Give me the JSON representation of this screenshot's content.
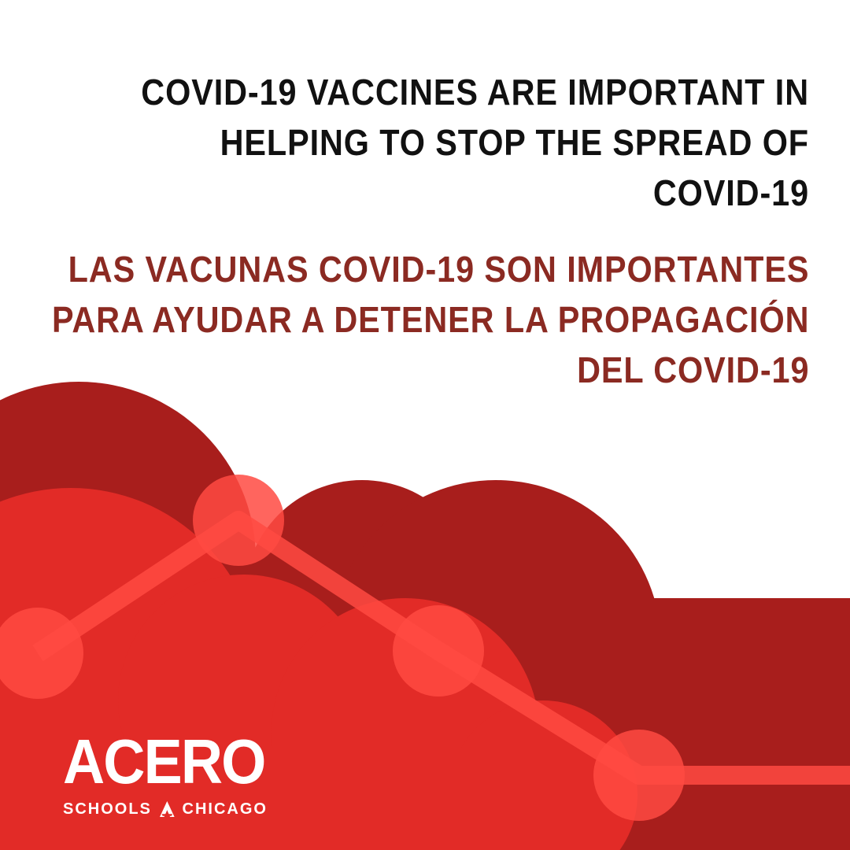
{
  "headline_en": {
    "lines": [
      "COVID-19 VACCINES ARE IMPORTANT IN",
      "HELPING TO STOP THE SPREAD OF",
      "COVID-19"
    ]
  },
  "headline_es": {
    "lines": [
      "LAS VACUNAS COVID-19 SON IMPORTANTES",
      "PARA AYUDAR A DETENER LA PROPAGACIÓN",
      "DEL COVID-19"
    ]
  },
  "logo": {
    "name": "ACERO",
    "left_word": "SCHOOLS",
    "right_word": "CHICAGO"
  },
  "colors": {
    "background": "#ffffff",
    "headline_en": "#111111",
    "headline_es": "#8b2a22",
    "cloud_back": "#a81e1c",
    "cloud_front": "#e22b27",
    "line_nodes": "#ff4a42",
    "logo_text": "#ffffff"
  },
  "icons": [
    "cloud-shape",
    "descending-line-graphic",
    "acero-a-mark-icon"
  ]
}
